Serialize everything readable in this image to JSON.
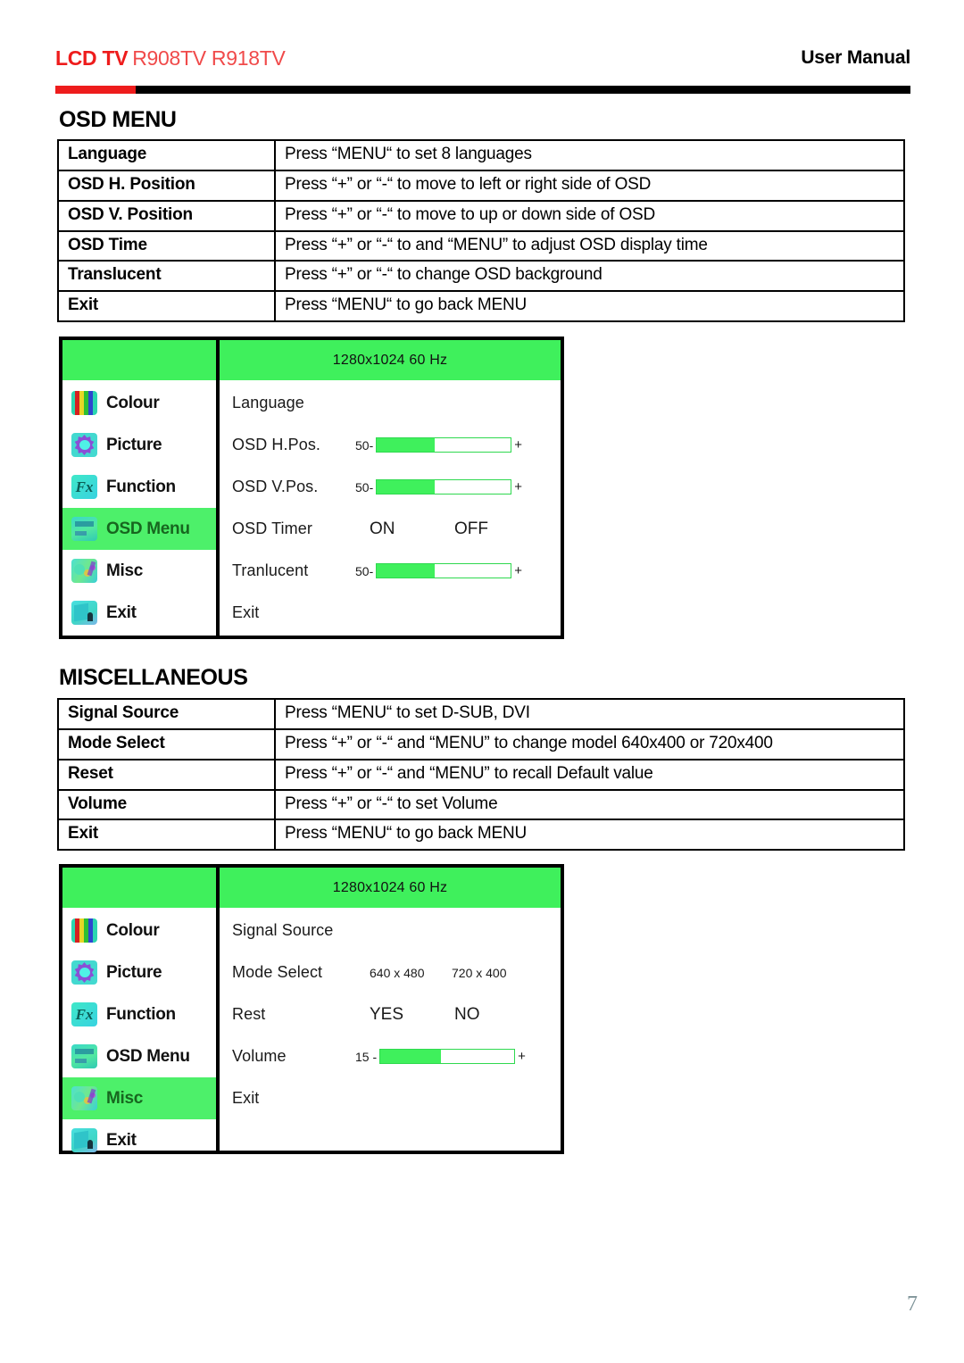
{
  "header": {
    "brand": "LCD TV",
    "models": "R908TV R918TV",
    "doc_type": "User Manual",
    "brand_color": "#ee1c1c",
    "rule_red_color": "#ee1c1c",
    "rule_black_color": "#000000"
  },
  "sections": [
    {
      "id": "osd-menu",
      "title": "OSD MENU",
      "rows": [
        {
          "label": "Language",
          "desc": "Press “MENU“ to set 8 languages"
        },
        {
          "label": "OSD H. Position",
          "desc": "Press “+” or “-“ to move to left or right side of OSD"
        },
        {
          "label": "OSD V. Position",
          "desc": "Press “+” or “-“ to move to up or down side of OSD"
        },
        {
          "label": "OSD Time",
          "desc": "Press “+” or “-“ to and “MENU” to adjust OSD display time"
        },
        {
          "label": "Translucent",
          "desc": "Press “+” or “-“ to change OSD background"
        },
        {
          "label": "Exit",
          "desc": "Press “MENU“ to go back MENU"
        }
      ]
    },
    {
      "id": "miscellaneous",
      "title": "MISCELLANEOUS",
      "rows": [
        {
          "label": "Signal Source",
          "desc": "Press “MENU“ to set D-SUB, DVI"
        },
        {
          "label": "Mode Select",
          "desc": "Press “+” or “-“ and “MENU” to change model 640x400 or 720x400"
        },
        {
          "label": "Reset",
          "desc": "Press “+” or “-“ and “MENU” to recall Default value"
        },
        {
          "label": "Volume",
          "desc": "Press “+” or “-“ to set Volume"
        },
        {
          "label": "Exit",
          "desc": "Press “MENU“ to go back MENU"
        }
      ]
    }
  ],
  "osd_screens": [
    {
      "id": "osd-screen-menu",
      "titlebar": "1280x1024  60 Hz",
      "accent_green": "#3ff05c",
      "highlight_green": "#4df06a",
      "sidebar": [
        {
          "label": "Colour",
          "icon": "colour-icon",
          "active": false
        },
        {
          "label": "Picture",
          "icon": "picture-icon",
          "active": false
        },
        {
          "label": "Function",
          "icon": "function-icon",
          "active": false
        },
        {
          "label": "OSD Menu",
          "icon": "osd-menu-icon",
          "active": true
        },
        {
          "label": "Misc",
          "icon": "misc-icon",
          "active": false
        },
        {
          "label": "Exit",
          "icon": "exit-icon",
          "active": false
        }
      ],
      "rows": [
        {
          "label": "Language",
          "control": "none"
        },
        {
          "label": "OSD  H.Pos.",
          "control": "slider",
          "value": "50-",
          "plus": "+",
          "fill_pct": 43
        },
        {
          "label": "OSD  V.Pos.",
          "control": "slider",
          "value": "50-",
          "plus": "+",
          "fill_pct": 43
        },
        {
          "label": "OSD  Timer",
          "control": "options",
          "opt_a": "ON",
          "opt_b": "OFF",
          "small": false
        },
        {
          "label": "Tranlucent",
          "control": "slider",
          "value": "50-",
          "plus": "+",
          "fill_pct": 43
        },
        {
          "label": "Exit",
          "control": "none"
        }
      ]
    },
    {
      "id": "osd-screen-misc",
      "titlebar": "1280x1024  60 Hz",
      "accent_green": "#3ff05c",
      "highlight_green": "#4df06a",
      "sidebar": [
        {
          "label": "Colour",
          "icon": "colour-icon",
          "active": false
        },
        {
          "label": "Picture",
          "icon": "picture-icon",
          "active": false
        },
        {
          "label": "Function",
          "icon": "function-icon",
          "active": false
        },
        {
          "label": "OSD Menu",
          "icon": "osd-menu-icon",
          "active": false
        },
        {
          "label": "Misc",
          "icon": "misc-icon",
          "active": true
        },
        {
          "label": "Exit",
          "icon": "exit-icon",
          "active": false
        }
      ],
      "rows": [
        {
          "label": "Signal  Source",
          "control": "none"
        },
        {
          "label": "Mode  Select",
          "control": "options",
          "opt_a": "640 x 480",
          "opt_b": "720 x 400",
          "small": true
        },
        {
          "label": "Rest",
          "control": "options",
          "opt_a": "YES",
          "opt_b": "NO",
          "small": false
        },
        {
          "label": "Volume",
          "control": "slider",
          "value": "15 -",
          "plus": "+",
          "fill_pct": 45
        },
        {
          "label": "Exit",
          "control": "none"
        }
      ]
    }
  ],
  "footer": {
    "page_number": "7"
  }
}
